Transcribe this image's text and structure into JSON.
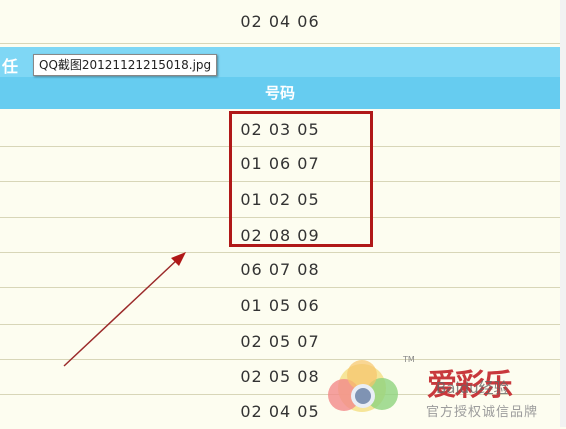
{
  "top_row": "02 04 06",
  "section_title": "任",
  "column_header": "号码",
  "tooltip": "QQ截图20121121215018.jpg",
  "rows": [
    "02 03 05",
    "01 06 07",
    "01 02 05",
    "02 08 09",
    "06 07 08",
    "01 05 06",
    "02 05 07",
    "02 05 08",
    "02 04 05"
  ],
  "watermark": {
    "brand": "爱彩乐",
    "baidu": "Baidu经验",
    "tagline": "官方授权诚信品牌",
    "tm": "TM"
  },
  "colors": {
    "header_light": "#7fd7f5",
    "header_dark": "#66ccf0",
    "highlight_border": "#b01818",
    "arrow": "#9b2a2a",
    "row_bg": "#fdfdf0"
  }
}
